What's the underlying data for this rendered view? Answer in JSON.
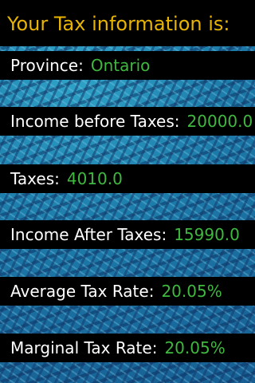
{
  "colors": {
    "title": "#e8b400",
    "value": "#3fb83f",
    "label": "#ffffff",
    "row_background": "#000000"
  },
  "header": {
    "title": "Your Tax information is:"
  },
  "rows": [
    {
      "label": "Province:",
      "value": "Ontario"
    },
    {
      "label": "Income before Taxes:",
      "value": "20000.0"
    },
    {
      "label": "Taxes:",
      "value": "4010.0"
    },
    {
      "label": "Income After Taxes:",
      "value": "15990.0"
    },
    {
      "label": "Average Tax Rate:",
      "value": "20.05%"
    },
    {
      "label": "Marginal Tax Rate:",
      "value": "20.05%"
    }
  ]
}
